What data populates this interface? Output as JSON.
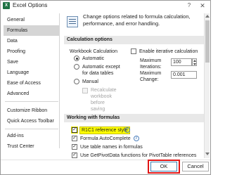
{
  "window": {
    "title": "Excel Options",
    "app_icon_glyph": "X",
    "help_glyph": "?",
    "close_glyph": "✕"
  },
  "sidebar": {
    "items": [
      {
        "label": "General",
        "selected": false
      },
      {
        "label": "Formulas",
        "selected": true
      },
      {
        "label": "Data",
        "selected": false
      },
      {
        "label": "Proofing",
        "selected": false
      },
      {
        "label": "Save",
        "selected": false
      },
      {
        "label": "Language",
        "selected": false
      },
      {
        "label": "Ease of Access",
        "selected": false
      },
      {
        "label": "Advanced",
        "selected": false
      },
      {
        "label": "Customize Ribbon",
        "selected": false
      },
      {
        "label": "Quick Access Toolbar",
        "selected": false
      },
      {
        "label": "Add-ins",
        "selected": false
      },
      {
        "label": "Trust Center",
        "selected": false
      }
    ]
  },
  "main": {
    "intro": "Change options related to formula calculation, performance, and error handling.",
    "calc_section": {
      "header": "Calculation options",
      "workbook_calc_label": "Workbook Calculation",
      "automatic": "Automatic",
      "automatic_except": "Automatic except for data tables",
      "manual": "Manual",
      "recalc_before_saving": "Recalculate workbook before saving",
      "enable_iterative": "Enable iterative calculation",
      "max_iterations_label": "Maximum Iterations:",
      "max_iterations_value": "100",
      "max_change_label": "Maximum Change:",
      "max_change_value": "0.001",
      "selected_mode": "automatic"
    },
    "formulas_section": {
      "header": "Working with formulas",
      "r1c1": "R1C1 reference style",
      "r1c1_checked": true,
      "autocomplete": "Formula AutoComplete",
      "autocomplete_checked": true,
      "table_names": "Use table names in formulas",
      "table_names_checked": true,
      "getpivotdata": "Use GetPivotData functions for PivotTable references",
      "getpivotdata_checked": true
    }
  },
  "footer": {
    "ok_label": "OK",
    "cancel_label": "Cancel"
  },
  "colors": {
    "highlight_yellow": "#ffff00",
    "ok_outline_red": "#e11515",
    "selected_sidebar": "#d5d5d5"
  }
}
